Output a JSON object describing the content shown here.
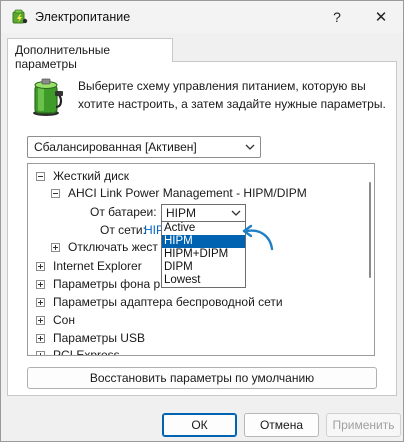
{
  "window": {
    "title": "Электропитание",
    "help_symbol": "?",
    "close_symbol": "✕"
  },
  "tab": {
    "label": "Дополнительные параметры"
  },
  "description": "Выберите схему управления питанием, которую вы хотите настроить, а затем задайте нужные параметры.",
  "scheme_select": {
    "value": "Сбалансированная [Активен]"
  },
  "tree": {
    "hard_disk": "Жесткий диск",
    "ahci": "AHCI Link Power Management - HIPM/DIPM",
    "on_battery_label": "От батареи:",
    "on_battery_value": "HIPM",
    "on_ac_label": "От сети:",
    "on_ac_value": "HIP",
    "disable_after": "Отключать жест",
    "items": [
      "Internet Explorer",
      "Параметры фона р",
      "Параметры адаптера беспроводной сети",
      "Сон",
      "Параметры USB",
      "PCI Express"
    ]
  },
  "dropdown_options": [
    "Active",
    "HIPM",
    "HIPM+DIPM",
    "DIPM",
    "Lowest"
  ],
  "dropdown_selected": "HIPM",
  "buttons": {
    "restore": "Восстановить параметры по умолчанию",
    "ok": "ОК",
    "cancel": "Отмена",
    "apply": "Применить"
  },
  "icons": {
    "app": "power-options-icon",
    "battery": "battery-power-icon",
    "chevron": "chevron-down-icon",
    "annotation": "curved-arrow-icon"
  },
  "colors": {
    "accent": "#0063b1",
    "annotation_arrow": "#1f7fc4",
    "link_value": "#0066cc"
  }
}
